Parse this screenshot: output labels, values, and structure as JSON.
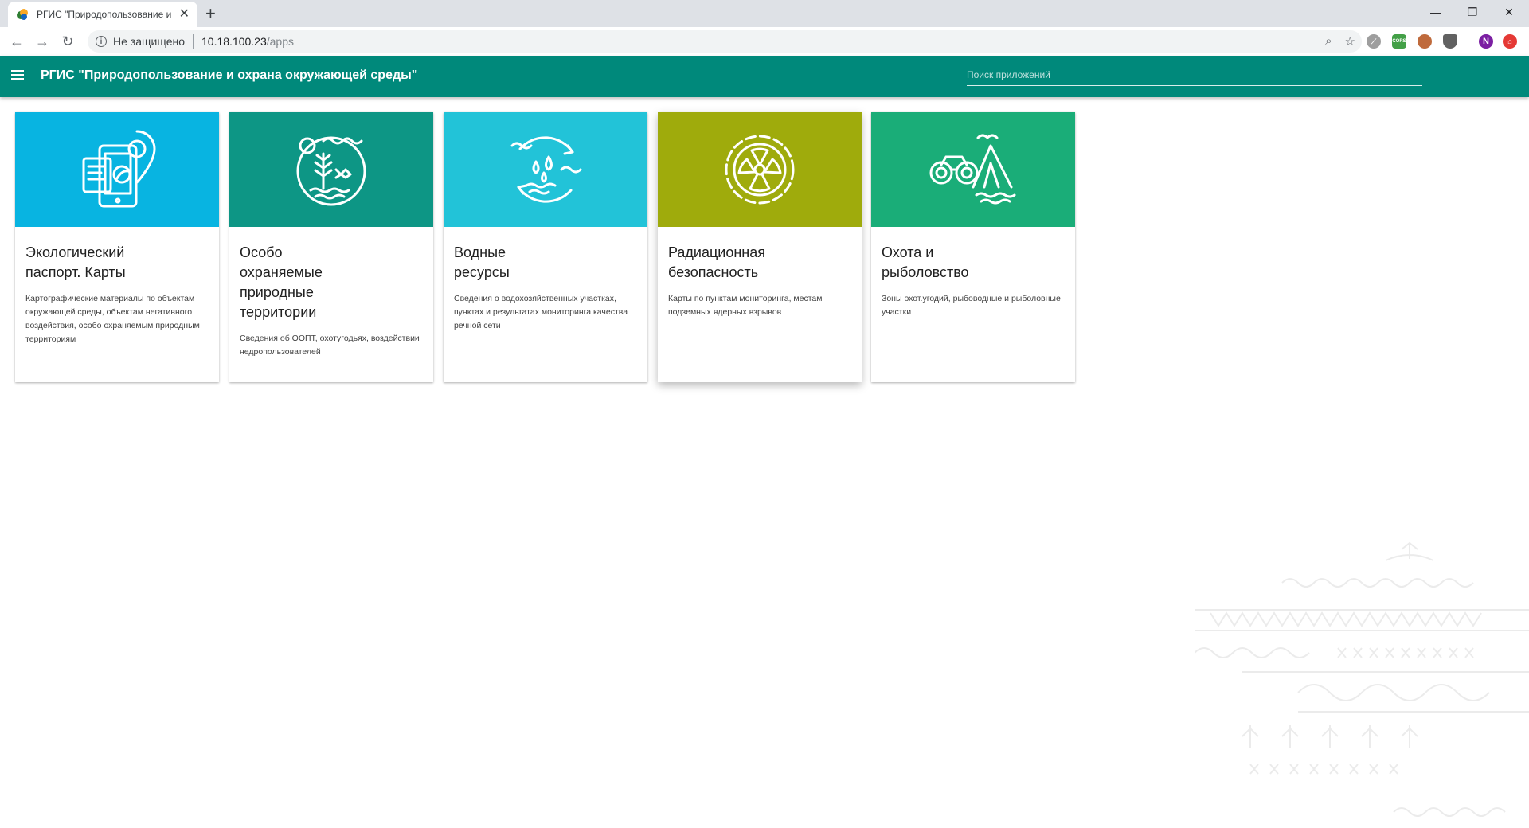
{
  "browser": {
    "tab_title": "РГИС \"Природопользование и охрана окружающей среды\"",
    "new_tab": "+",
    "security_label": "Не защищено",
    "url_host": "10.18.100.23",
    "url_path": "/apps",
    "profile_initial": "N",
    "extension_label": "CORS"
  },
  "app": {
    "title": "РГИС \"Природопользование и охрана окружающей среды\"",
    "search_placeholder": "Поиск приложений"
  },
  "cards": [
    {
      "title": "Экологический паспорт. Карты",
      "description": "Картографические материалы по объектам окружающей среды, объектам негативного воздействия, особо охраняемым природным территориям",
      "color": "#08b4e1",
      "icon": "tablet-map-icon"
    },
    {
      "title": "Особо охраняемые природные территории",
      "description": "Сведения об ООПТ, охотугодьях, воздействии недропользователей",
      "color": "#0d9685",
      "icon": "nature-reserve-icon"
    },
    {
      "title": "Водные ресурсы",
      "description": "Сведения о водохозяйственных участках, пунктах и результатах мониторинга качества речной сети",
      "color": "#22c3d8",
      "icon": "water-cycle-icon"
    },
    {
      "title": "Радиационная безопасность",
      "description": "Карты по пунктам мониторинга, местам подземных ядерных взрывов",
      "color": "#9fab0c",
      "icon": "radiation-icon"
    },
    {
      "title": "Охота и рыболовство",
      "description": "Зоны охот.угодий, рыбоводные и рыболовные участки",
      "color": "#1aad78",
      "icon": "binoculars-tent-icon"
    }
  ]
}
